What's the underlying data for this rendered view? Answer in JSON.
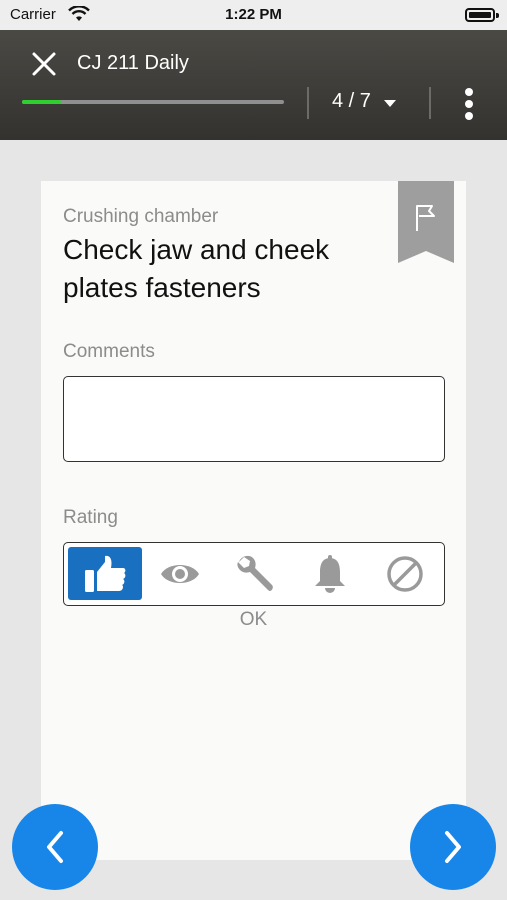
{
  "status_bar": {
    "carrier": "Carrier",
    "time": "1:22 PM"
  },
  "header": {
    "title": "CJ 211 Daily",
    "step_indicator": "4 / 7",
    "progress_fraction": 0.15,
    "progress_color": "#2fcf2f"
  },
  "task": {
    "category": "Crushing chamber",
    "title": "Check jaw and cheek plates fasteners",
    "comments_label": "Comments",
    "comments_value": "",
    "rating_label": "Rating",
    "rating_options": [
      {
        "icon": "thumbs-up-icon",
        "selected": true
      },
      {
        "icon": "eye-icon",
        "selected": false
      },
      {
        "icon": "wrench-icon",
        "selected": false
      },
      {
        "icon": "bell-icon",
        "selected": false
      },
      {
        "icon": "prohibited-icon",
        "selected": false
      }
    ],
    "rating_caption": "OK"
  },
  "colors": {
    "accent": "#1a70c0",
    "fab": "#1886e8",
    "header": "#3d3c38"
  },
  "navigation": {
    "previous_icon": "chevron-left-icon",
    "next_icon": "chevron-right-icon"
  }
}
